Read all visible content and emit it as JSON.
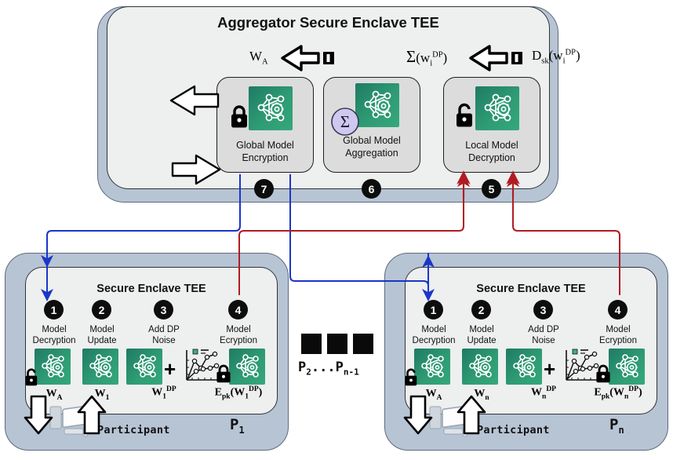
{
  "aggregator": {
    "side_label": "Aggregator",
    "tee_title": "Aggregator Secure Enclave TEE",
    "formulas": {
      "w_a": "W_A",
      "sum_dp": "Σ(w_i^DP)",
      "dsk_dp": "D_sk(w_i^DP)"
    },
    "cards": [
      {
        "id": "global-model-encryption",
        "line1": "Global Model",
        "line2": "Encryption",
        "step": "7",
        "icon": "lock-closed-icon"
      },
      {
        "id": "global-model-aggregation",
        "line1": "Global Model",
        "line2": "Aggregation",
        "step": "6",
        "icon": "sigma-icon"
      },
      {
        "id": "local-model-decryption",
        "line1": "Local Model",
        "line2": "Decryption",
        "step": "5",
        "icon": "lock-open-icon"
      }
    ],
    "cloud_icon": "cloud-server-icon"
  },
  "participants": [
    {
      "id": "p1",
      "tee_title": "Secure Enclave TEE",
      "label": "P",
      "label_sub": "1",
      "participant_word": "Participant",
      "steps": [
        {
          "num": "1",
          "line1": "Model",
          "line2": "Decryption",
          "weight": "W_A",
          "icon": "lock-open-icon"
        },
        {
          "num": "2",
          "line1": "Model",
          "line2": "Update",
          "weight": "W_1",
          "icon": "nn-icon"
        },
        {
          "num": "3",
          "line1": "Add DP",
          "line2": "Noise",
          "weight": "W_1^DP",
          "icon": "chart-icon"
        },
        {
          "num": "4",
          "line1": "Model",
          "line2": "Ecryption",
          "weight": "E_pk(W_1^DP)",
          "icon": "lock-closed-icon"
        }
      ]
    },
    {
      "id": "pn",
      "tee_title": "Secure Enclave TEE",
      "label": "P",
      "label_sub": "n",
      "participant_word": "Participant",
      "steps": [
        {
          "num": "1",
          "line1": "Model",
          "line2": "Decryption",
          "weight": "W_A",
          "icon": "lock-open-icon"
        },
        {
          "num": "2",
          "line1": "Model",
          "line2": "Update",
          "weight": "W_n",
          "icon": "nn-icon"
        },
        {
          "num": "3",
          "line1": "Add DP",
          "line2": "Noise",
          "weight": "W_n^DP",
          "icon": "chart-icon"
        },
        {
          "num": "4",
          "line1": "Model",
          "line2": "Ecryption",
          "weight": "E_pk(W_n^DP)",
          "icon": "lock-closed-icon"
        }
      ]
    }
  ],
  "middle": {
    "ellipsis_label": "P₂...Pₙ",
    "label_head": "P",
    "sub1": "2",
    "sub2": "n-1"
  },
  "colors": {
    "panel_fill": "#b7c4d4",
    "panel_stroke": "#5d6b7a",
    "tee_fill": "#eeefef",
    "tee_stroke": "#2f3338",
    "card_fill": "#dcdcdc",
    "nn_green_dark": "#1f7a63",
    "nn_green_light": "#35a87c",
    "flow_blue": "#1b35c8",
    "flow_red": "#b01c22",
    "bullet_black": "#0d0d0d",
    "sigma_circle": "#cfc9ef",
    "cloud_blue": "#9ec2e8"
  }
}
